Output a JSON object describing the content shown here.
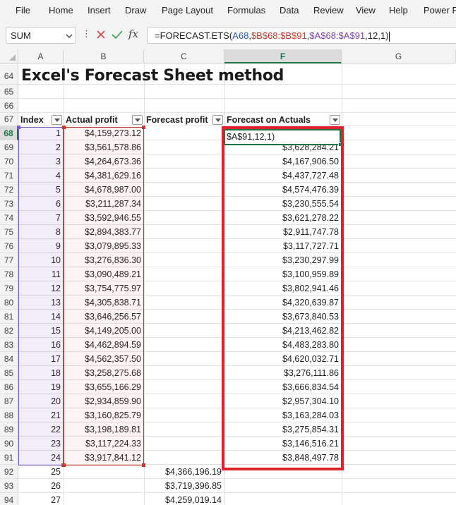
{
  "menu": {
    "items": [
      "File",
      "Home",
      "Insert",
      "Draw",
      "Page Layout",
      "Formulas",
      "Data",
      "Review",
      "View",
      "Help",
      "Power P"
    ]
  },
  "formula_bar": {
    "name_box": "SUM",
    "dots": "⋮",
    "fx": "fx",
    "formula": {
      "prefix": "=FORECAST.ETS(",
      "ref1": "A68",
      "sep1": ",",
      "ref2": "$B$68:$B$91",
      "sep2": ",",
      "ref3": "$A$68:$A$91",
      "suffix": ",12,1)"
    }
  },
  "columns": [
    "A",
    "B",
    "C",
    "F",
    "G"
  ],
  "title": "Excel's Forecast Sheet method",
  "table_headers": {
    "index": "Index",
    "actual": "Actual profit",
    "forecast": "Forecast profit",
    "forecast_actuals": "Forecast on Actuals"
  },
  "editing_cell_text": "$A$91,12,1)",
  "rows": [
    {
      "num": "64"
    },
    {
      "num": "65"
    },
    {
      "num": "66"
    },
    {
      "num": "67"
    },
    {
      "num": "68",
      "index": "1",
      "actual": "$4,159,273.12",
      "forecast_actuals": ""
    },
    {
      "num": "69",
      "index": "2",
      "actual": "$3,561,578.86",
      "forecast_actuals": "$3,628,284.21"
    },
    {
      "num": "70",
      "index": "3",
      "actual": "$4,264,673.36",
      "forecast_actuals": "$4,167,906.50"
    },
    {
      "num": "71",
      "index": "4",
      "actual": "$4,381,629.16",
      "forecast_actuals": "$4,437,727.48"
    },
    {
      "num": "72",
      "index": "5",
      "actual": "$4,678,987.00",
      "forecast_actuals": "$4,574,476.39"
    },
    {
      "num": "73",
      "index": "6",
      "actual": "$3,211,287.34",
      "forecast_actuals": "$3,230,555.54"
    },
    {
      "num": "74",
      "index": "7",
      "actual": "$3,592,946.55",
      "forecast_actuals": "$3,621,278.22"
    },
    {
      "num": "75",
      "index": "8",
      "actual": "$2,894,383.77",
      "forecast_actuals": "$2,911,747.78"
    },
    {
      "num": "76",
      "index": "9",
      "actual": "$3,079,895.33",
      "forecast_actuals": "$3,117,727.71"
    },
    {
      "num": "77",
      "index": "10",
      "actual": "$3,276,836.30",
      "forecast_actuals": "$3,230,297.99"
    },
    {
      "num": "78",
      "index": "11",
      "actual": "$3,090,489.21",
      "forecast_actuals": "$3,100,959.89"
    },
    {
      "num": "79",
      "index": "12",
      "actual": "$3,754,775.97",
      "forecast_actuals": "$3,802,941.46"
    },
    {
      "num": "80",
      "index": "13",
      "actual": "$4,305,838.71",
      "forecast_actuals": "$4,320,639.87"
    },
    {
      "num": "81",
      "index": "14",
      "actual": "$3,646,256.57",
      "forecast_actuals": "$3,673,840.53"
    },
    {
      "num": "82",
      "index": "15",
      "actual": "$4,149,205.00",
      "forecast_actuals": "$4,213,462.82"
    },
    {
      "num": "83",
      "index": "16",
      "actual": "$4,462,894.59",
      "forecast_actuals": "$4,483,283.80"
    },
    {
      "num": "84",
      "index": "17",
      "actual": "$4,562,357.50",
      "forecast_actuals": "$4,620,032.71"
    },
    {
      "num": "85",
      "index": "18",
      "actual": "$3,258,275.68",
      "forecast_actuals": "$3,276,111.86"
    },
    {
      "num": "86",
      "index": "19",
      "actual": "$3,655,166.29",
      "forecast_actuals": "$3,666,834.54"
    },
    {
      "num": "87",
      "index": "20",
      "actual": "$2,934,859.90",
      "forecast_actuals": "$2,957,304.10"
    },
    {
      "num": "88",
      "index": "21",
      "actual": "$3,160,825.79",
      "forecast_actuals": "$3,163,284.03"
    },
    {
      "num": "89",
      "index": "22",
      "actual": "$3,198,189.81",
      "forecast_actuals": "$3,275,854.31"
    },
    {
      "num": "90",
      "index": "23",
      "actual": "$3,117,224.33",
      "forecast_actuals": "$3,146,516.21"
    },
    {
      "num": "91",
      "index": "24",
      "actual": "$3,917,841.12",
      "forecast_actuals": "$3,848,497.78"
    },
    {
      "num": "92",
      "index": "25",
      "forecast": "$4,366,196.19"
    },
    {
      "num": "93",
      "index": "26",
      "forecast": "$3,719,396.85"
    },
    {
      "num": "94",
      "index": "27",
      "forecast": "$4,259,019.14"
    }
  ],
  "colors": {
    "excel_green": "#217346",
    "highlight_red": "#e0202a",
    "index_range": "#7b5bc8",
    "actual_range": "#c0392b"
  }
}
